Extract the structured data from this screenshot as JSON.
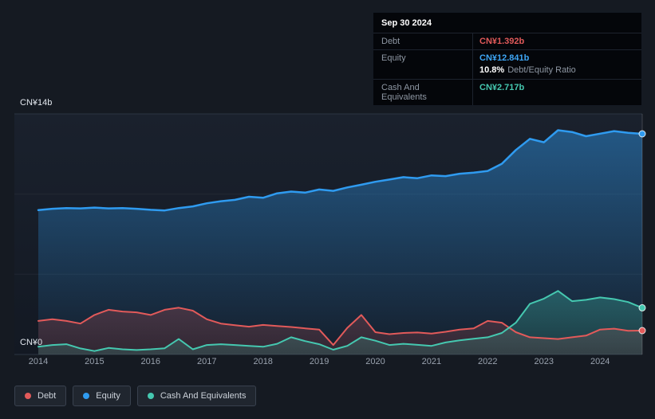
{
  "tooltip": {
    "date": "Sep 30 2024",
    "debt_label": "Debt",
    "debt_value": "CN¥1.392b",
    "equity_label": "Equity",
    "equity_value": "CN¥12.841b",
    "ratio_value": "10.8%",
    "ratio_label": "Debt/Equity Ratio",
    "cash_label": "Cash And Equivalents",
    "cash_value": "CN¥2.717b"
  },
  "legend": [
    {
      "key": "debt",
      "label": "Debt",
      "color": "#e25a5a"
    },
    {
      "key": "equity",
      "label": "Equity",
      "color": "#2f9bf0"
    },
    {
      "key": "cash",
      "label": "Cash And Equivalents",
      "color": "#45c8b0"
    }
  ],
  "colors": {
    "background": "#151a22",
    "tooltip_background": "#04060a",
    "grid_major": "#2c3542",
    "debt": "#e25a5a",
    "equity": "#2f9bf0",
    "cash": "#45c8b0"
  },
  "chart_data": {
    "type": "area",
    "title": "Debt, Equity and Cash history (CN¥ billions)",
    "xlim": [
      2014,
      2024.75
    ],
    "ylim": [
      0,
      14
    ],
    "y_axis_labels": {
      "top": "CN¥14b",
      "bottom": "CN¥0"
    },
    "grid_values": [
      14,
      9.333,
      4.667,
      0
    ],
    "x_ticks": [
      2014,
      2015,
      2016,
      2017,
      2018,
      2019,
      2020,
      2021,
      2022,
      2023,
      2024
    ],
    "x": [
      2014.0,
      2014.25,
      2014.5,
      2014.75,
      2015.0,
      2015.25,
      2015.5,
      2015.75,
      2016.0,
      2016.25,
      2016.5,
      2016.75,
      2017.0,
      2017.25,
      2017.5,
      2017.75,
      2018.0,
      2018.25,
      2018.5,
      2018.75,
      2019.0,
      2019.25,
      2019.5,
      2019.75,
      2020.0,
      2020.25,
      2020.5,
      2020.75,
      2021.0,
      2021.25,
      2021.5,
      2021.75,
      2022.0,
      2022.25,
      2022.5,
      2022.75,
      2023.0,
      2023.25,
      2023.5,
      2023.75,
      2024.0,
      2024.25,
      2024.5,
      2024.75
    ],
    "series": [
      {
        "key": "equity",
        "name": "Equity",
        "color": "#2f9bf0",
        "values": [
          8.4,
          8.48,
          8.52,
          8.5,
          8.55,
          8.5,
          8.52,
          8.48,
          8.42,
          8.38,
          8.52,
          8.62,
          8.8,
          8.92,
          9.0,
          9.18,
          9.12,
          9.38,
          9.48,
          9.42,
          9.6,
          9.52,
          9.72,
          9.88,
          10.05,
          10.18,
          10.32,
          10.26,
          10.42,
          10.38,
          10.52,
          10.58,
          10.68,
          11.1,
          11.9,
          12.55,
          12.35,
          13.05,
          12.95,
          12.7,
          12.85,
          13.0,
          12.9,
          12.841
        ]
      },
      {
        "key": "debt",
        "name": "Debt",
        "color": "#e25a5a",
        "values": [
          1.95,
          2.05,
          1.95,
          1.8,
          2.3,
          2.6,
          2.5,
          2.45,
          2.3,
          2.6,
          2.72,
          2.55,
          2.05,
          1.8,
          1.7,
          1.62,
          1.72,
          1.66,
          1.6,
          1.52,
          1.45,
          0.55,
          1.55,
          2.3,
          1.3,
          1.18,
          1.25,
          1.28,
          1.22,
          1.32,
          1.45,
          1.52,
          1.95,
          1.85,
          1.3,
          1.0,
          0.95,
          0.9,
          1.0,
          1.1,
          1.45,
          1.5,
          1.38,
          1.392
        ]
      },
      {
        "key": "cash",
        "name": "Cash And Equivalents",
        "color": "#45c8b0",
        "values": [
          0.45,
          0.55,
          0.6,
          0.35,
          0.2,
          0.38,
          0.3,
          0.26,
          0.3,
          0.36,
          0.9,
          0.3,
          0.55,
          0.6,
          0.55,
          0.5,
          0.45,
          0.62,
          1.0,
          0.78,
          0.6,
          0.28,
          0.5,
          1.0,
          0.8,
          0.55,
          0.62,
          0.56,
          0.5,
          0.7,
          0.82,
          0.92,
          1.0,
          1.25,
          1.85,
          2.95,
          3.25,
          3.7,
          3.1,
          3.18,
          3.32,
          3.22,
          3.05,
          2.717
        ]
      }
    ]
  }
}
